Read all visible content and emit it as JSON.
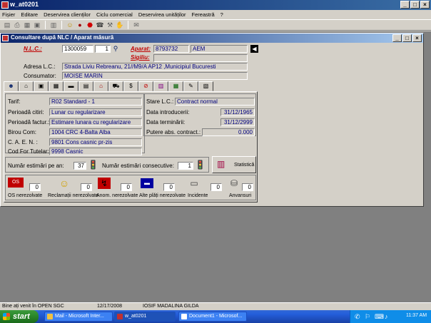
{
  "app": {
    "title": "w_at0201",
    "menu": [
      "Fișier",
      "Editare",
      "Deservirea clienților",
      "Ciclu comercial",
      "Deservirea unităților",
      "Fereastră",
      "?"
    ]
  },
  "toolbar": {
    "icons": [
      "new-icon",
      "print-icon",
      "print-preview-icon",
      "save-icon",
      "delete-icon",
      "smiley-icon",
      "bomb-icon",
      "stop-icon",
      "phone-icon",
      "wrench-icon",
      "hand-icon",
      "mail-icon"
    ]
  },
  "window": {
    "title": "Consultare după NLC / Aparat măsură",
    "nlc_label": "N.L.C.:",
    "nlc_value": "1300059",
    "nlc_suffix": "1",
    "aparat_label": "Aparat:",
    "aparat_value": "8793732",
    "aparat_type": "AEM",
    "sigiliu_label": "Sigiliu:",
    "adresa_label": "Adresa L.C.:",
    "adresa_value": "Strada Liviu Rebreanu, 21//M9/A AP12 ,Municipiul Bucuresti",
    "consumator_label": "Consumator:",
    "consumator_value": "MOISE MARIN"
  },
  "details": {
    "tarif_label": "Tarif:",
    "tarif_value": "R02 Standard - 1",
    "stare_label": "Stare L.C.:",
    "stare_value": "Contract normal",
    "perioada_citiri_label": "Perioadă citiri:",
    "perioada_citiri_value": "Lunar cu regularizare",
    "data_intro_label": "Data introducerii:",
    "data_intro_value": "31/12/1965",
    "perioada_factur_label": "Perioadă factur.:",
    "perioada_factur_value": "Estimare lunara cu regularizare",
    "data_term_label": "Data terminării:",
    "data_term_value": "31/12/2999",
    "birou_label": "Birou Com:",
    "birou_value": "1004  CRC 4-Balta Alba",
    "putere_label": "Putere abs. contract.:",
    "putere_value": "0.000",
    "caen_label": "C. A. E. N. :",
    "caen_value": "9801  Cons casnic pr-zis",
    "cod_label": "Cod For Tutelar:",
    "cod_value": "9998  Casnic",
    "estimari_an_label": "Număr estimări pe an:",
    "estimari_an_value": "37",
    "estimari_cons_label": "Număr estimări consecutive:",
    "estimari_cons_value": "1",
    "statistica_label": "Statistică"
  },
  "counters": [
    {
      "label": "OS nerezolvate",
      "value": "0",
      "icon": "os-icon"
    },
    {
      "label": "Reclamații nerezolvate",
      "value": "0",
      "icon": "smiley-icon"
    },
    {
      "label": "Anom. nerezolvate",
      "value": "0",
      "icon": "anomaly-icon"
    },
    {
      "label": "Alte plăți nerezolvate",
      "value": "0",
      "icon": "card-icon"
    },
    {
      "label": "Incidente",
      "value": "0",
      "icon": "incident-icon"
    },
    {
      "label": "Anvansuri",
      "value": "0",
      "icon": "coins-icon"
    }
  ],
  "status": {
    "message": "Bine ați venit în OPEN SGC",
    "date": "12/17/2008",
    "user": "IOSIF MADALINA GILDA"
  },
  "taskbar": {
    "start": "start",
    "tasks": [
      "Mail - Microsoft Inter...",
      "w_at0201",
      "Document1 - Microsof..."
    ],
    "clock": "11:37 AM"
  },
  "colors": {
    "title_active": "#0a246a",
    "face": "#d4d0c8",
    "field_text": "#000080",
    "label_red": "#c00000",
    "taskbar": "#245edb",
    "start": "#2d8a2d"
  }
}
